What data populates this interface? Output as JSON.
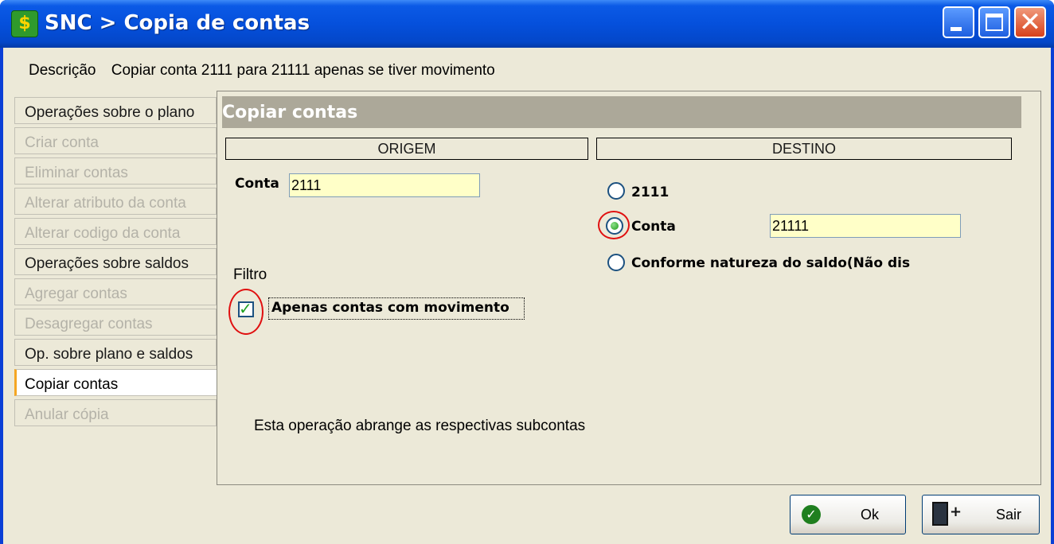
{
  "window": {
    "title": "SNC > Copia de contas",
    "app_icon_glyph": "$",
    "controls": [
      "minimize",
      "maximize",
      "close"
    ]
  },
  "description": {
    "label": "Descrição",
    "value": "Copiar conta 2111 para 21111 apenas se tiver movimento"
  },
  "sidebar": {
    "items": [
      {
        "label": "Operações sobre o plano",
        "kind": "header",
        "enabled": true
      },
      {
        "label": "Criar conta",
        "kind": "item",
        "enabled": false
      },
      {
        "label": "Eliminar contas",
        "kind": "item",
        "enabled": false
      },
      {
        "label": "Alterar atributo da conta",
        "kind": "item",
        "enabled": false
      },
      {
        "label": "Alterar codigo da conta",
        "kind": "item",
        "enabled": false
      },
      {
        "label": "Operações sobre saldos",
        "kind": "header",
        "enabled": true
      },
      {
        "label": "Agregar contas",
        "kind": "item",
        "enabled": false
      },
      {
        "label": "Desagregar contas",
        "kind": "item",
        "enabled": false
      },
      {
        "label": "Op. sobre plano e saldos",
        "kind": "header",
        "enabled": true
      },
      {
        "label": "Copiar contas",
        "kind": "item",
        "enabled": true,
        "selected": true
      },
      {
        "label": "Anular cópia",
        "kind": "item",
        "enabled": false
      }
    ]
  },
  "panel": {
    "title": "Copiar contas",
    "origem": {
      "group_label": "ORIGEM",
      "conta_label": "Conta",
      "conta_value": "2111",
      "filter_label": "Filtro",
      "filter_checkbox_label": "Apenas contas com movimento",
      "filter_checked": true
    },
    "destino": {
      "group_label": "DESTINO",
      "options": [
        {
          "label": "2111",
          "selected": false
        },
        {
          "label": "Conta",
          "selected": true
        },
        {
          "label": "Conforme natureza do saldo(Não dis",
          "selected": false
        }
      ],
      "conta_value": "21111"
    },
    "note": "Esta operação abrange as respectivas subcontas"
  },
  "buttons": {
    "ok": "Ok",
    "exit": "Sair"
  },
  "colors": {
    "titlebar": "#0550dc",
    "input_bg": "#ffffc8",
    "highlight_ring": "#e01010",
    "panel_header": "#aca899"
  }
}
